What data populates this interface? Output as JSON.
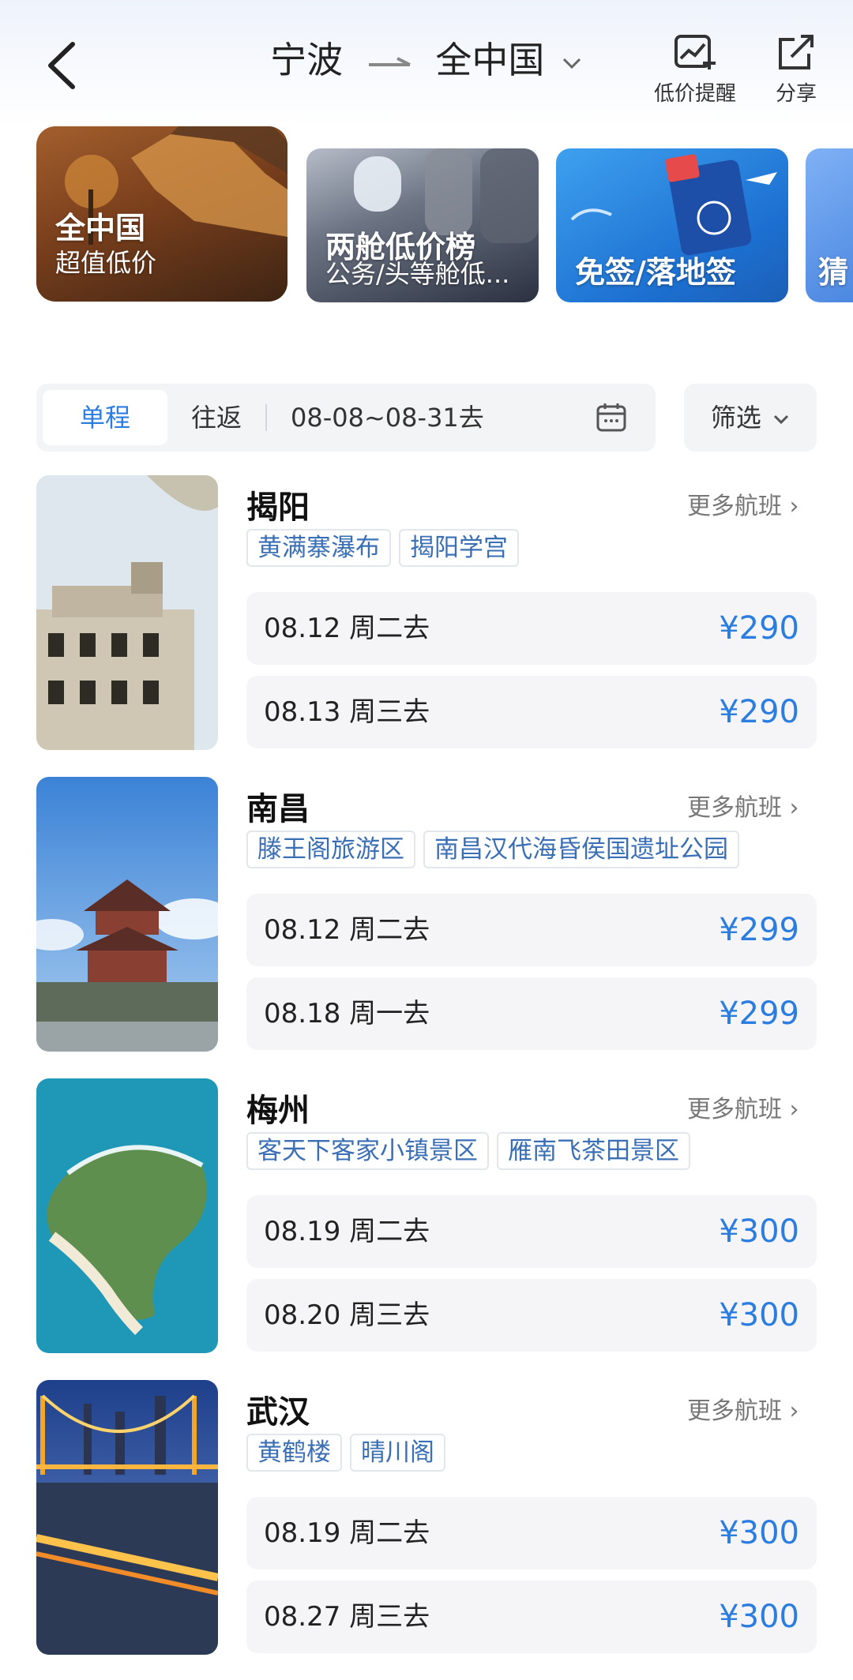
{
  "header": {
    "origin": "宁波",
    "destination": "全中国",
    "alert_label": "低价提醒",
    "share_label": "分享"
  },
  "banners": [
    {
      "title": "全中国",
      "subtitle": "超值低价"
    },
    {
      "title": "两舱低价榜",
      "subtitle": "公务/头等舱低..."
    },
    {
      "title": "免签/落地签",
      "subtitle": ""
    },
    {
      "title": "猜",
      "subtitle": ""
    }
  ],
  "filters": {
    "one_way": "单程",
    "round_trip": "往返",
    "date_range": "08-08~08-31去",
    "filter_label": "筛选"
  },
  "destinations": [
    {
      "city": "揭阳",
      "more": "更多航班",
      "tags": [
        "黄满寨瀑布",
        "揭阳学宫"
      ],
      "flights": [
        {
          "date": "08.12  周二去",
          "price": "¥290"
        },
        {
          "date": "08.13  周三去",
          "price": "¥290"
        }
      ]
    },
    {
      "city": "南昌",
      "more": "更多航班",
      "tags": [
        "滕王阁旅游区",
        "南昌汉代海昏侯国遗址公园"
      ],
      "flights": [
        {
          "date": "08.12  周二去",
          "price": "¥299"
        },
        {
          "date": "08.18  周一去",
          "price": "¥299"
        }
      ]
    },
    {
      "city": "梅州",
      "more": "更多航班",
      "tags": [
        "客天下客家小镇景区",
        "雁南飞茶田景区"
      ],
      "flights": [
        {
          "date": "08.19  周二去",
          "price": "¥300"
        },
        {
          "date": "08.20  周三去",
          "price": "¥300"
        }
      ]
    },
    {
      "city": "武汉",
      "more": "更多航班",
      "tags": [
        "黄鹤楼",
        "晴川阁"
      ],
      "flights": [
        {
          "date": "08.19  周二去",
          "price": "¥300"
        },
        {
          "date": "08.27  周三去",
          "price": "¥300"
        }
      ]
    }
  ],
  "colors": {
    "accent": "#2b7de0",
    "tag_text": "#3a6fb5",
    "card_bg": "#f5f5f7"
  }
}
